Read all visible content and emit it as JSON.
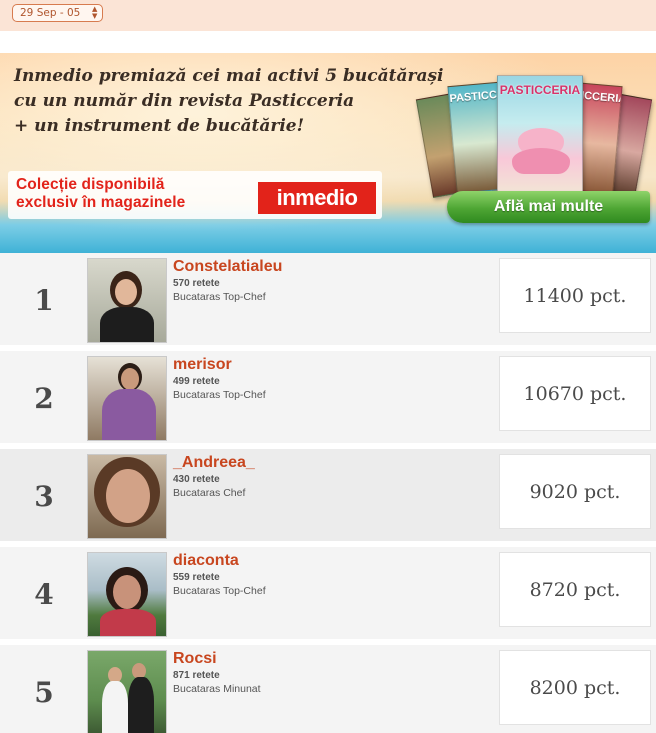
{
  "date_picker": {
    "selected": "29 Sep - 05"
  },
  "banner": {
    "headline": [
      "Inmedio premiază cei  mai activi 5 bucătărași",
      "cu un număr din revista Pasticceria",
      "+ un instrument de bucătărie!"
    ],
    "promo_lines": [
      "Colecție disponibilă",
      "exclusiv în magazinele"
    ],
    "brand_logo": "inmedio",
    "magazine_title": "PASTICCERIA",
    "cta_label": "Află mai multe",
    "colors": {
      "promo_red": "#e2231a",
      "cta_green": "#4ea634"
    }
  },
  "ranking": [
    {
      "rank": "1",
      "name": "Constelatialeu",
      "recipes": "570 retete",
      "level": "Bucataras Top-Chef",
      "score": "11400 pct."
    },
    {
      "rank": "2",
      "name": "merisor",
      "recipes": "499 retete",
      "level": "Bucataras Top-Chef",
      "score": "10670 pct."
    },
    {
      "rank": "3",
      "name": "_Andreea_",
      "recipes": "430 retete",
      "level": "Bucataras Chef",
      "score": "9020 pct."
    },
    {
      "rank": "4",
      "name": "diaconta",
      "recipes": "559 retete",
      "level": "Bucataras Top-Chef",
      "score": "8720 pct."
    },
    {
      "rank": "5",
      "name": "Rocsi",
      "recipes": "871 retete",
      "level": "Bucataras Minunat",
      "score": "8200 pct."
    }
  ],
  "colors": {
    "username": "#c8461f",
    "top_bar": "#fbe4d6"
  }
}
